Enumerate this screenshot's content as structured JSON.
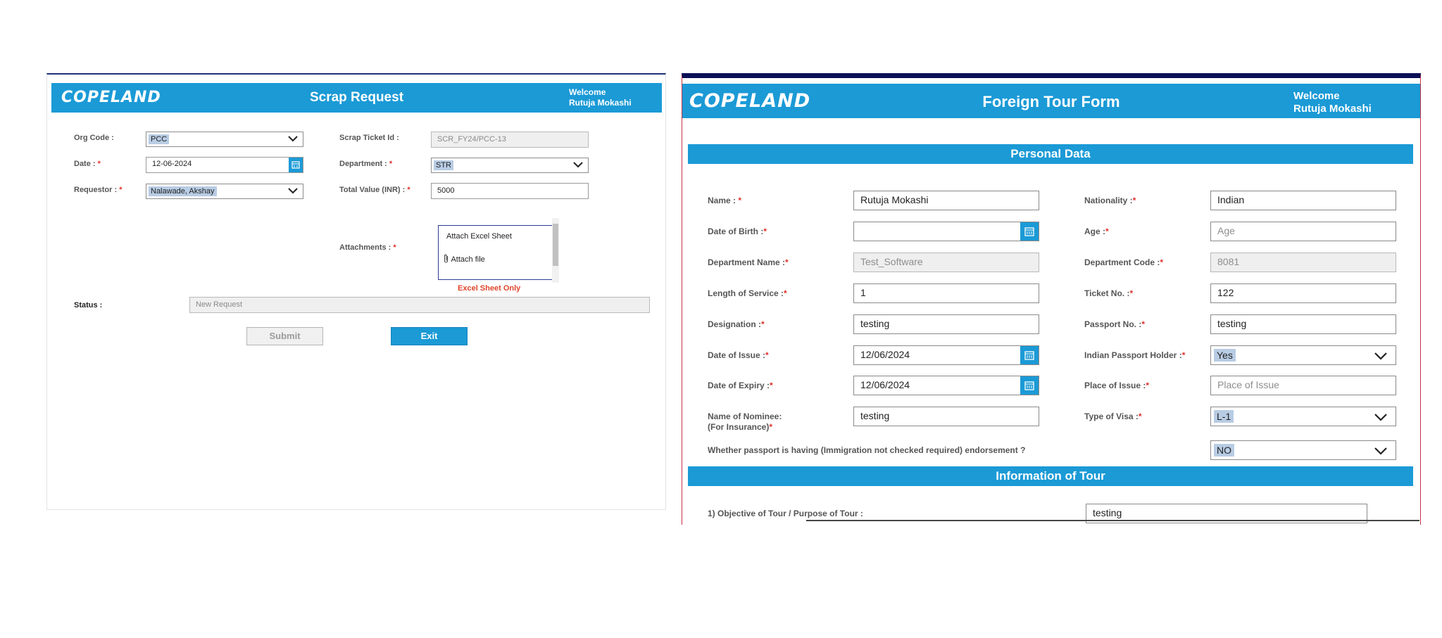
{
  "scrap": {
    "brand": "COPELAND",
    "title": "Scrap Request",
    "welcome": "Welcome",
    "user": "Rutuja Mokashi",
    "org_code_label": "Org Code :",
    "org_code_value": "PCC",
    "date_label": "Date :",
    "date_value": "12-06-2024",
    "requestor_label": "Requestor :",
    "requestor_value": "Nalawade, Akshay",
    "ticket_label": "Scrap Ticket Id :",
    "ticket_value": "SCR_FY24/PCC-13",
    "department_label": "Department :",
    "department_value": "STR",
    "total_label": "Total Value (INR) :",
    "total_value": "5000",
    "attachments_label": "Attachments :",
    "attach_excel": "Attach Excel Sheet",
    "attach_file": "Attach file",
    "excel_note": "Excel Sheet Only",
    "status_label": "Status :",
    "status_value": "New Request",
    "submit_label": "Submit",
    "exit_label": "Exit",
    "required_mark": "*"
  },
  "tour": {
    "brand": "COPELAND",
    "title": "Foreign Tour Form",
    "welcome": "Welcome",
    "user": "Rutuja Mokashi",
    "section_personal": "Personal Data",
    "section_tour": "Information of Tour",
    "name_label": "Name :",
    "name_value": "Rutuja Mokashi",
    "dob_label": "Date of Birth :",
    "dob_value": "",
    "dept_name_label": "Department Name :",
    "dept_name_value": "Test_Software",
    "los_label": "Length of Service :",
    "los_value": "1",
    "designation_label": "Designation :",
    "designation_value": "testing",
    "doi_label": "Date of Issue :",
    "doi_value": "12/06/2024",
    "doe_label": "Date of Expiry :",
    "doe_value": "12/06/2024",
    "nominee_label": "Name of Nominee:",
    "nominee_sub_label": "(For Insurance)",
    "nominee_value": "testing",
    "nationality_label": "Nationality :",
    "nationality_value": "Indian",
    "age_label": "Age :",
    "age_placeholder": "Age",
    "dept_code_label": "Department Code :",
    "dept_code_value": "8081",
    "ticket_label": "Ticket No. :",
    "ticket_value": "122",
    "passport_label": "Passport No. :",
    "passport_value": "testing",
    "ipp_label": "Indian Passport Holder :",
    "ipp_value": "Yes",
    "poi_label": "Place of Issue :",
    "poi_placeholder": "Place of Issue",
    "visa_label": "Type of Visa :",
    "visa_value": "L-1",
    "endorse_question": "Whether passport is having (Immigration not checked required) endorsement ?",
    "endorse_value": "NO",
    "objective_label": "1) Objective of Tour / Purpose of Tour :",
    "objective_value": "testing",
    "required_mark": "*"
  },
  "colors": {
    "header_blue": "#1b9ad6",
    "required_red": "#e0302b",
    "excel_note": "#e0452b",
    "highlight": "#b8cce4"
  },
  "icons": [
    "chevron-down-icon",
    "calendar-icon",
    "paperclip-icon"
  ]
}
